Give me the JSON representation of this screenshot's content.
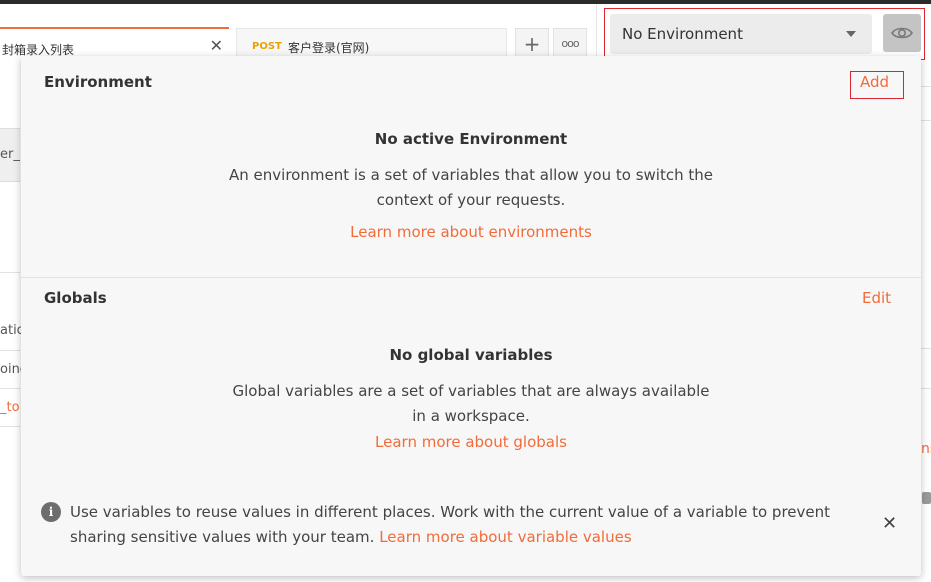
{
  "tabs": {
    "active": {
      "title": "封箱录入列表",
      "close_glyph": "✕"
    },
    "second": {
      "method": "POST",
      "title": "客户登录(官网)"
    },
    "new_tab_glyph": "+",
    "more_glyph": "ooo"
  },
  "environment_selector": {
    "selected": "No Environment"
  },
  "background": {
    "frag1": "er_",
    "frag2": "atio",
    "frag3": "oing",
    "frag4": "_to",
    "frag5": "ns"
  },
  "popover": {
    "environment": {
      "title": "Environment",
      "action": "Add",
      "empty_title": "No active Environment",
      "empty_desc": "An environment is a set of variables that allow you to switch the context of your requests.",
      "learn_link": "Learn more about environments"
    },
    "globals": {
      "title": "Globals",
      "action": "Edit",
      "empty_title": "No global variables",
      "empty_desc": "Global variables are a set of variables that are always available in a workspace.",
      "learn_link": "Learn more about globals"
    },
    "info": {
      "text": "Use variables to reuse values in different places. Work with the current value of a variable to prevent sharing sensitive values with your team.",
      "link": "Learn more about variable values",
      "close_glyph": "✕"
    }
  },
  "colors": {
    "accent": "#f26b3a",
    "highlight": "#d9262f",
    "method_post": "#e8a200"
  }
}
